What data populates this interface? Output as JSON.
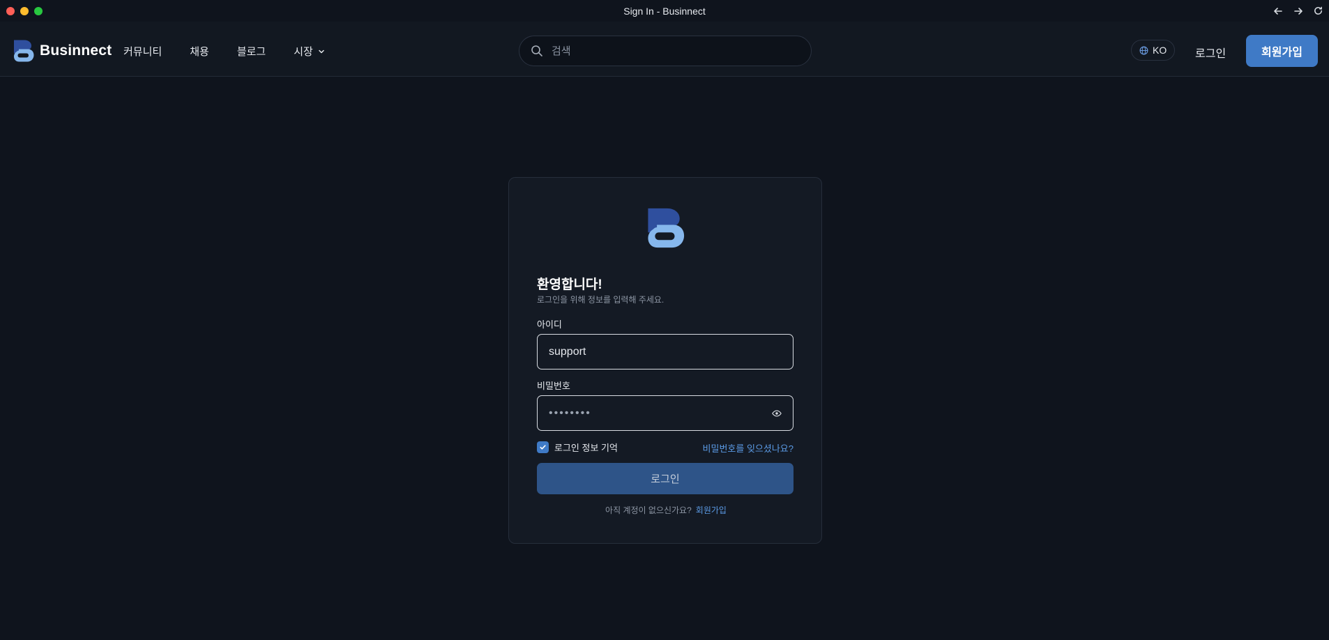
{
  "window": {
    "title": "Sign In - Businnect"
  },
  "header": {
    "brand": "Businnect",
    "menu": [
      {
        "label": "커뮤니티"
      },
      {
        "label": "채용"
      },
      {
        "label": "블로그"
      },
      {
        "label": "시장"
      }
    ],
    "search": {
      "placeholder": "검색",
      "value": ""
    },
    "language": "KO",
    "login_label": "로그인",
    "signup_label": "회원가입"
  },
  "login": {
    "welcome": "환영합니다!",
    "subtitle": "로그인을 위해 정보를 입력해 주세요.",
    "id_label": "아이디",
    "id_value": "support",
    "password_label": "비밀번호",
    "password_mask": "••••••••",
    "remember_label": "로그인 정보 기억",
    "remember_checked": true,
    "forgot_label": "비밀번호를 잊으셨나요?",
    "submit_label": "로그인",
    "no_account_text": "아직 계정이 없으신가요?",
    "signup_link": "회원가입"
  },
  "colors": {
    "background": "#0f141d",
    "accent": "#3f7ac6",
    "link": "#5b9be6"
  },
  "icons": [
    "back-arrow-icon",
    "forward-arrow-icon",
    "reload-icon",
    "search-icon",
    "globe-icon",
    "chevron-down-icon",
    "eye-icon",
    "check-icon"
  ]
}
